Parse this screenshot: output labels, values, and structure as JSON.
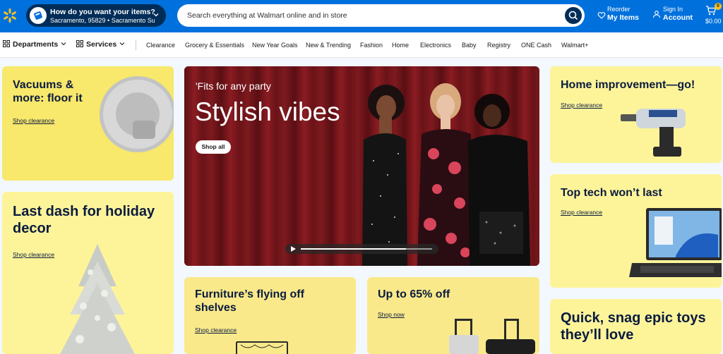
{
  "header": {
    "location_title": "How do you want your items?",
    "location_sub": "Sacramento, 95829 • Sacramento Su...",
    "search_placeholder": "Search everything at Walmart online and in store",
    "reorder_small": "Reorder",
    "reorder_big": "My Items",
    "signin_small": "Sign In",
    "signin_big": "Account",
    "cart_count": "0",
    "cart_total": "$0.00",
    "brand_color": "#0071dc",
    "accent_color": "#ffc220",
    "icons": [
      "spark-logo-icon",
      "location-icon",
      "chevron-down-icon",
      "search-icon",
      "heart-icon",
      "user-icon",
      "cart-icon"
    ]
  },
  "nav": {
    "departments": "Departments",
    "services": "Services",
    "links": [
      "Clearance",
      "Grocery & Essentials",
      "New Year Goals",
      "New & Trending",
      "Fashion",
      "Home",
      "Electronics",
      "Baby",
      "Registry",
      "ONE Cash",
      "Walmart+"
    ]
  },
  "cards": {
    "vacuums": {
      "title": "Vacuums & more: floor it",
      "cta": "Shop clearance"
    },
    "holiday": {
      "title": "Last dash for holiday decor",
      "cta": "Shop clearance"
    },
    "hero": {
      "kicker": "'Fits for any party",
      "title": "Stylish vibes",
      "button": "Shop all",
      "video_progress": 0.8
    },
    "furniture": {
      "title": "Furniture’s flying off shelves",
      "cta": "Shop clearance"
    },
    "sale": {
      "title": "Up to 65% off",
      "cta": "Shop now"
    },
    "home_improvement": {
      "title": "Home improvement—go!",
      "cta": "Shop clearance"
    },
    "tech": {
      "title": "Top tech won’t last",
      "cta": "Shop clearance"
    },
    "toys": {
      "title": "Quick, snag epic toys they’ll love"
    }
  },
  "colors": {
    "card_yellow": "#fdf49a",
    "text_navy": "#0b1b3f",
    "hero_red": "#6e1419"
  }
}
